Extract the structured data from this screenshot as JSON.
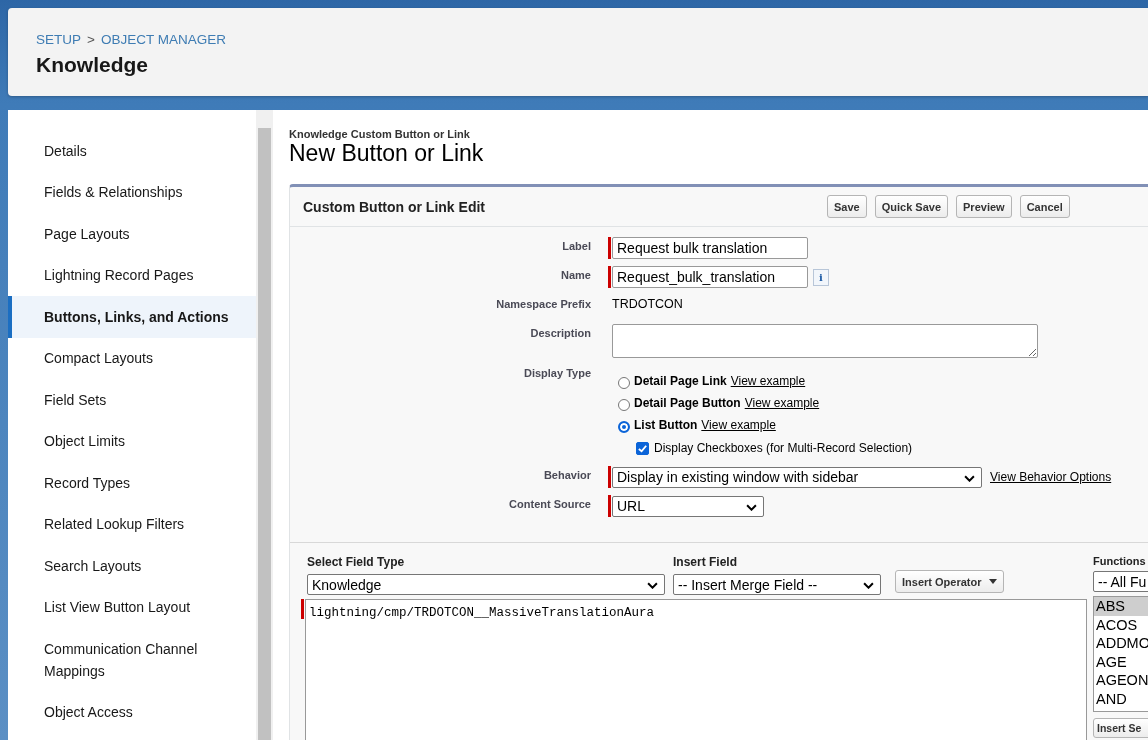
{
  "breadcrumb": [
    {
      "label": "SETUP"
    },
    {
      "label": "OBJECT MANAGER"
    }
  ],
  "breadcrumb_separator": ">",
  "object_title": "Knowledge",
  "sidebar": {
    "items": [
      {
        "label": "Details",
        "selected": false
      },
      {
        "label": "Fields & Relationships",
        "selected": false
      },
      {
        "label": "Page Layouts",
        "selected": false
      },
      {
        "label": "Lightning Record Pages",
        "selected": false
      },
      {
        "label": "Buttons, Links, and Actions",
        "selected": true
      },
      {
        "label": "Compact Layouts",
        "selected": false
      },
      {
        "label": "Field Sets",
        "selected": false
      },
      {
        "label": "Object Limits",
        "selected": false
      },
      {
        "label": "Record Types",
        "selected": false
      },
      {
        "label": "Related Lookup Filters",
        "selected": false
      },
      {
        "label": "Search Layouts",
        "selected": false
      },
      {
        "label": "List View Button Layout",
        "selected": false
      },
      {
        "label": "Communication Channel Mappings",
        "selected": false
      },
      {
        "label": "Object Access",
        "selected": false
      }
    ]
  },
  "page": {
    "subtitle": "Knowledge Custom Button or Link",
    "title": "New Button or Link"
  },
  "panel": {
    "title": "Custom Button or Link Edit",
    "buttons": [
      "Save",
      "Quick Save",
      "Preview",
      "Cancel"
    ]
  },
  "form": {
    "label": {
      "label": "Label",
      "value": "Request bulk translation"
    },
    "name": {
      "label": "Name",
      "value": "Request_bulk_translation",
      "info": "i"
    },
    "namespace": {
      "label": "Namespace Prefix",
      "value": "TRDOTCON"
    },
    "description": {
      "label": "Description"
    },
    "display_type": {
      "label": "Display Type",
      "options": [
        {
          "label": "Detail Page Link",
          "link": "View example",
          "selected": false
        },
        {
          "label": "Detail Page Button",
          "link": "View example",
          "selected": false
        },
        {
          "label": "List Button",
          "link": "View example",
          "selected": true
        }
      ],
      "checkbox": {
        "label": "Display Checkboxes (for Multi-Record Selection)",
        "checked": true
      }
    },
    "behavior": {
      "label": "Behavior",
      "value": "Display in existing window with sidebar",
      "link": "View Behavior Options"
    },
    "content_source": {
      "label": "Content Source",
      "value": "URL"
    }
  },
  "editor": {
    "field_type": {
      "label": "Select Field Type",
      "value": "Knowledge"
    },
    "insert_field": {
      "label": "Insert Field",
      "value": "-- Insert Merge Field --"
    },
    "insert_operator": "Insert Operator",
    "code": "lightning/cmp/TRDOTCON__MassiveTranslationAura",
    "functions": {
      "label": "Functions",
      "value": "-- All Fu",
      "items": [
        {
          "label": "ABS",
          "selected": true
        },
        {
          "label": "ACOS",
          "selected": false
        },
        {
          "label": "ADDMO",
          "selected": false
        },
        {
          "label": "AGE",
          "selected": false
        },
        {
          "label": "AGEON",
          "selected": false
        },
        {
          "label": "AND",
          "selected": false
        }
      ],
      "button": "Insert Se"
    }
  }
}
